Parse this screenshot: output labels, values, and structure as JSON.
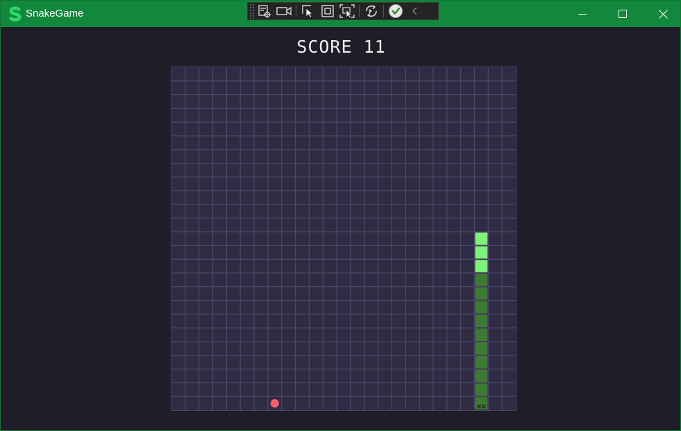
{
  "window": {
    "title": "SnakeGame",
    "titlebar_color": "#11883c",
    "logo_color": "#2ed66a"
  },
  "debug_toolbar": {
    "buttons": [
      {
        "name": "visual-tree-icon"
      },
      {
        "name": "record-icon"
      },
      {
        "name": "select-element-icon"
      },
      {
        "name": "display-layout-adorners-icon"
      },
      {
        "name": "track-focused-element-icon"
      },
      {
        "name": "hot-reload-icon"
      },
      {
        "name": "binding-failures-icon"
      },
      {
        "name": "collapse-toolbar-icon"
      }
    ]
  },
  "game": {
    "score_label": "SCORE",
    "score_value": "11",
    "grid": {
      "columns": 25,
      "rows": 25
    },
    "colors": {
      "board_bg": "#2f2b42",
      "grid_line": "#4d4669",
      "snake_head": "#7ef27a",
      "snake_body": "#3d7a36",
      "food": "#f0606a",
      "dead_marker": "#1c2a1a"
    },
    "snake": {
      "head_segments": [
        [
          22,
          12
        ],
        [
          22,
          13
        ],
        [
          22,
          14
        ]
      ],
      "body_segments": [
        [
          22,
          15
        ],
        [
          22,
          16
        ],
        [
          22,
          17
        ],
        [
          22,
          18
        ],
        [
          22,
          19
        ],
        [
          22,
          20
        ],
        [
          22,
          21
        ],
        [
          22,
          22
        ],
        [
          22,
          23
        ],
        [
          22,
          24
        ]
      ],
      "dead_tail": [
        22,
        24
      ]
    },
    "food": [
      7,
      24
    ]
  }
}
